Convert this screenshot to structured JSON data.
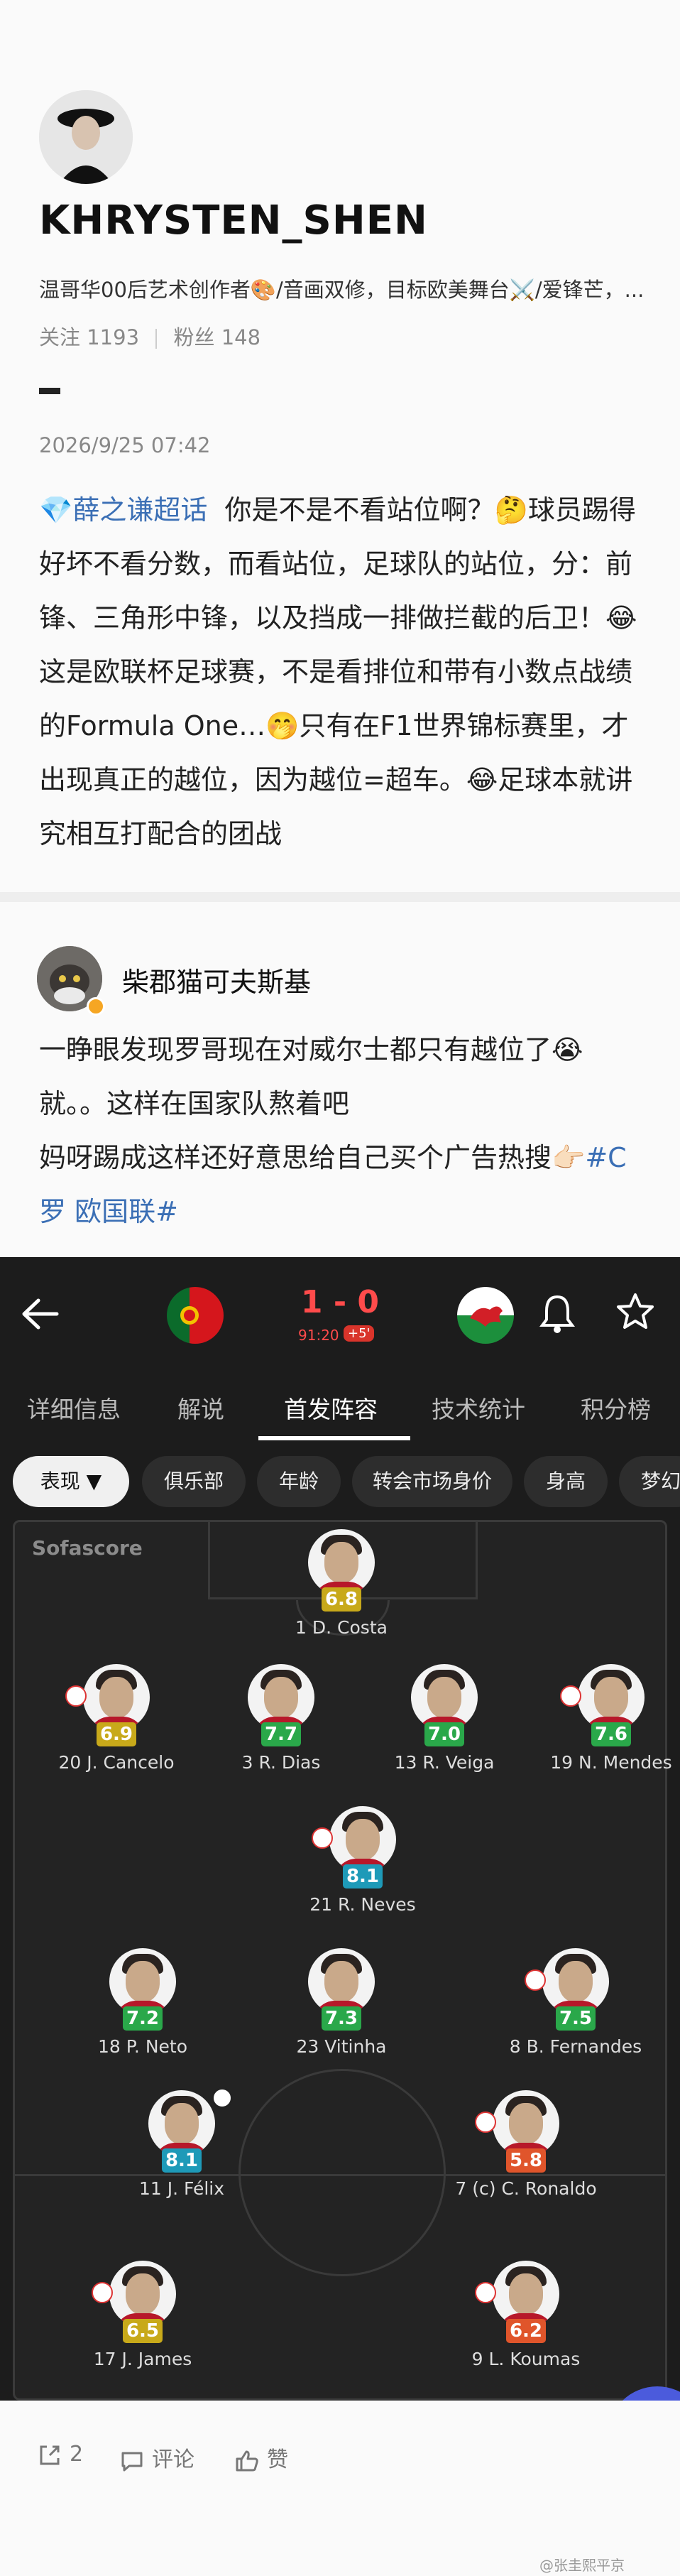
{
  "post1": {
    "username": "KHRYSTEN_SHEN",
    "bio": "温哥华00后艺术创作者🎨/音画双修，目标欧美舞台⚔️/爱锋芒，...",
    "following_label": "关注",
    "following_count": "1193",
    "followers_label": "粉丝",
    "followers_count": "148",
    "date": "2026/9/25 07:42",
    "topic": "💎薛之谦超话",
    "text": "你是不是不看站位啊？🤔球员踢得好坏不看分数，而看站位，足球队的站位，分：前锋、三角形中锋，以及挡成一排做拦截的后卫！😂这是欧联杯足球赛，不是看排位和带有小数点战绩的Formula One…🤭只有在F1世界锦标赛里，才出现真正的越位，因为越位=超车。😂足球本就讲究相互打配合的团战"
  },
  "post2": {
    "author": "柴郡猫可夫斯基",
    "line1": "一睁眼发现罗哥现在对威尔士都只有越位了😭",
    "line2": "就。。这样在国家队熬着吧",
    "line3": "妈呀踢成这样还好意思给自己买个广告热搜👉🏻",
    "hashtag": "#C罗 欧国联#"
  },
  "match": {
    "score": "1 - 0",
    "minute": "91:20",
    "added": "+5'",
    "tabs": [
      "详细信息",
      "解说",
      "首发阵容",
      "技术统计",
      "积分榜"
    ],
    "chips": [
      "表现 ▼",
      "俱乐部",
      "年龄",
      "转会市场身价",
      "身高",
      "梦幻"
    ],
    "brand": "Sofascore",
    "players": [
      {
        "name": "1 D. Costa",
        "rating": "6.8",
        "color": "#c8a91a"
      },
      {
        "name": "20 J. Cancelo",
        "rating": "6.9",
        "color": "#c8a91a"
      },
      {
        "name": "3 R. Dias",
        "rating": "7.7",
        "color": "#2aa84a"
      },
      {
        "name": "13 R. Veiga",
        "rating": "7.0",
        "color": "#2aa84a"
      },
      {
        "name": "19 N. Mendes",
        "rating": "7.6",
        "color": "#2aa84a"
      },
      {
        "name": "21 R. Neves",
        "rating": "8.1",
        "color": "#1e9ab8"
      },
      {
        "name": "18 P. Neto",
        "rating": "7.2",
        "color": "#2aa84a"
      },
      {
        "name": "23 Vitinha",
        "rating": "7.3",
        "color": "#2aa84a"
      },
      {
        "name": "8 B. Fernandes",
        "rating": "7.5",
        "color": "#2aa84a"
      },
      {
        "name": "11 J. Félix",
        "rating": "8.1",
        "color": "#1e9ab8"
      },
      {
        "name": "7 (c) C. Ronaldo",
        "rating": "5.8",
        "color": "#e0552b"
      },
      {
        "name": "17 J. James",
        "rating": "6.5",
        "color": "#c8a91a"
      },
      {
        "name": "9 L. Koumas",
        "rating": "6.2",
        "color": "#e0552b"
      }
    ]
  },
  "footer": {
    "share_count": "2",
    "comment_label": "评论",
    "like_label": "赞",
    "watermark": "@张圭熙平京"
  },
  "colors": {
    "topic_blue": "#3b6fb5",
    "score_red": "#ff4b4b"
  }
}
